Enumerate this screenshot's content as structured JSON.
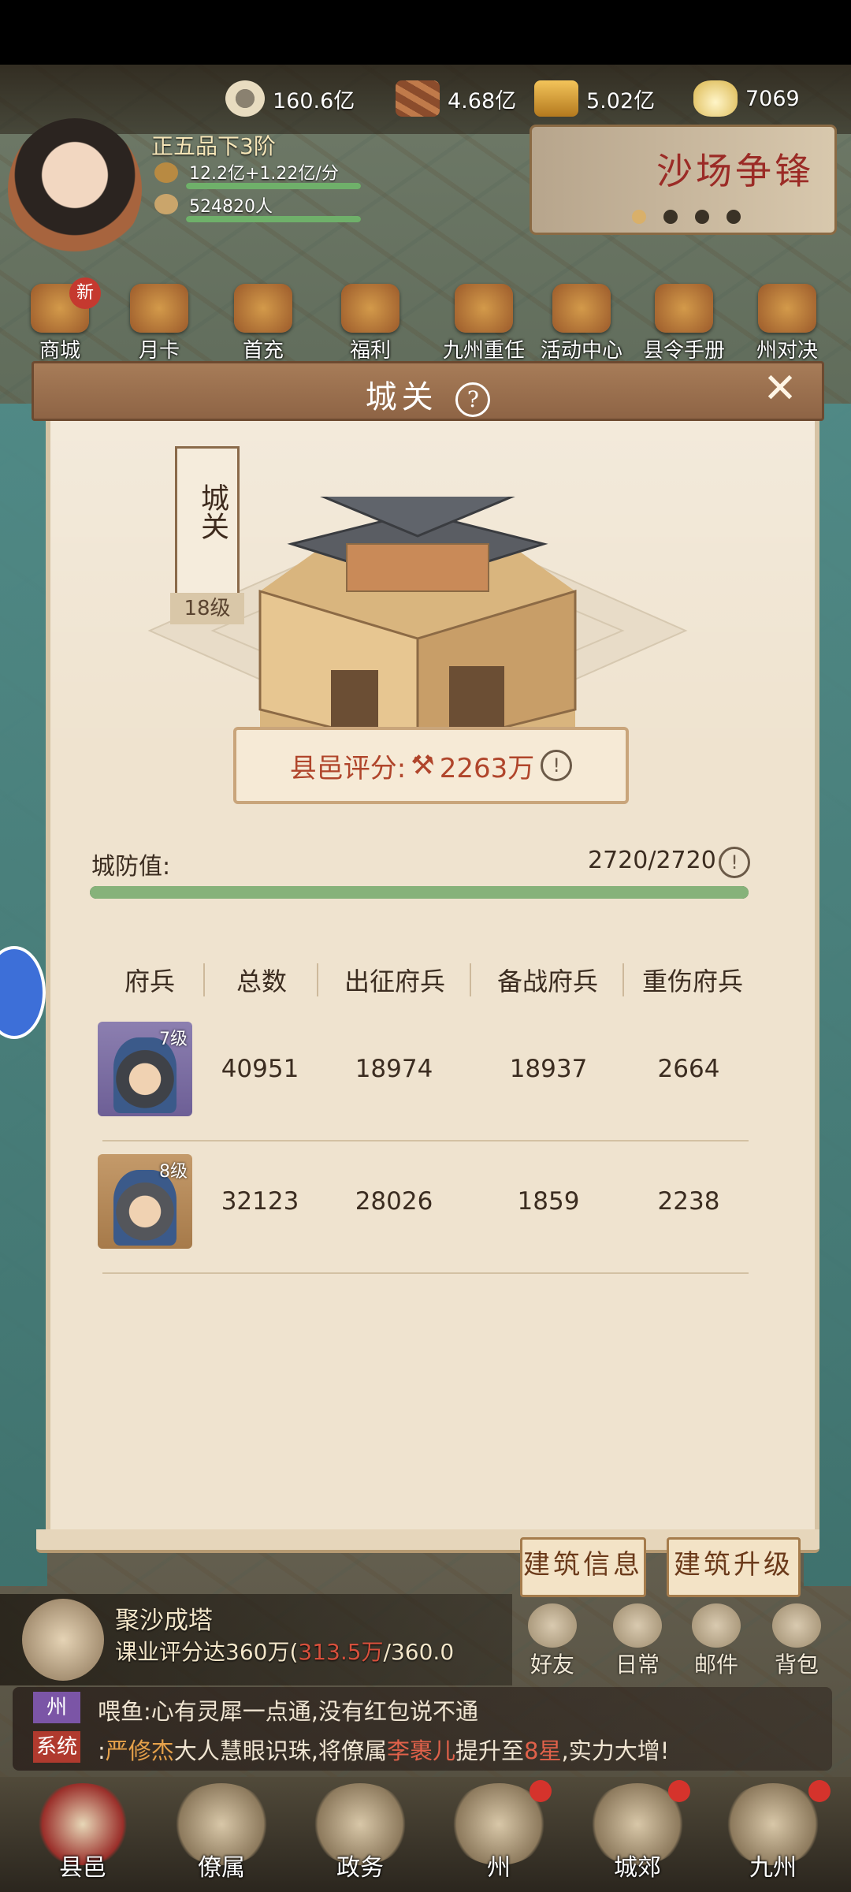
{
  "resources": [
    {
      "icon": "copper-coin-icon",
      "value": "160.6亿"
    },
    {
      "icon": "wood-logs-icon",
      "value": "4.68亿"
    },
    {
      "icon": "gold-bars-icon",
      "value": "5.02亿"
    },
    {
      "icon": "silver-ingot-icon",
      "value": "7069"
    }
  ],
  "player": {
    "rank": "正五品下3阶",
    "income": "12.2亿+1.22亿/分",
    "population": "524820人"
  },
  "banner": {
    "title": "沙场争锋"
  },
  "top_menu": [
    "商城",
    "月卡",
    "首充",
    "福利",
    "九州重任",
    "活动中心",
    "县令手册",
    "州对决"
  ],
  "badges": {
    "new": "新"
  },
  "modal": {
    "title": "城关",
    "building_name": "城关",
    "building_level": "18级",
    "score_label": "县邑评分:",
    "score_value": "2263万",
    "defense_label": "城防值:",
    "defense_value": "2720/2720",
    "defense_fraction": 1.0,
    "table": {
      "headers": [
        "府兵",
        "总数",
        "出征府兵",
        "备战府兵",
        "重伤府兵"
      ],
      "rows": [
        {
          "level": "7级",
          "total": "40951",
          "deployed": "18974",
          "reserve": "18937",
          "wounded": "2664"
        },
        {
          "level": "8级",
          "total": "32123",
          "deployed": "28026",
          "reserve": "1859",
          "wounded": "2238"
        }
      ]
    },
    "buttons": {
      "info": "建筑信息",
      "upgrade": "建筑升级"
    }
  },
  "task": {
    "title": "聚沙成塔",
    "desc_prefix": "课业评分达360万(",
    "progress": "313.5万",
    "desc_suffix": "/360.0"
  },
  "side_icons": [
    "好友",
    "日常",
    "邮件",
    "背包"
  ],
  "chat": [
    {
      "tag": "州",
      "tag_color": "#7b55a6",
      "text": "喂鱼:心有灵犀一点通,没有红包说不通"
    },
    {
      "tag": "系统",
      "tag_color": "#b03a2e",
      "p1": ":",
      "name": "严修杰",
      "p2": "大人慧眼识珠,将僚属",
      "name2": "李裹儿",
      "p3": "提升至",
      "star": "8星",
      "p4": ",实力大增!"
    }
  ],
  "bottom_nav": [
    "县邑",
    "僚属",
    "政务",
    "州",
    "城郊",
    "九州"
  ],
  "colors": {
    "accent": "#b0452b",
    "bar_green": "#86b27a",
    "paper": "#efe3cf"
  }
}
